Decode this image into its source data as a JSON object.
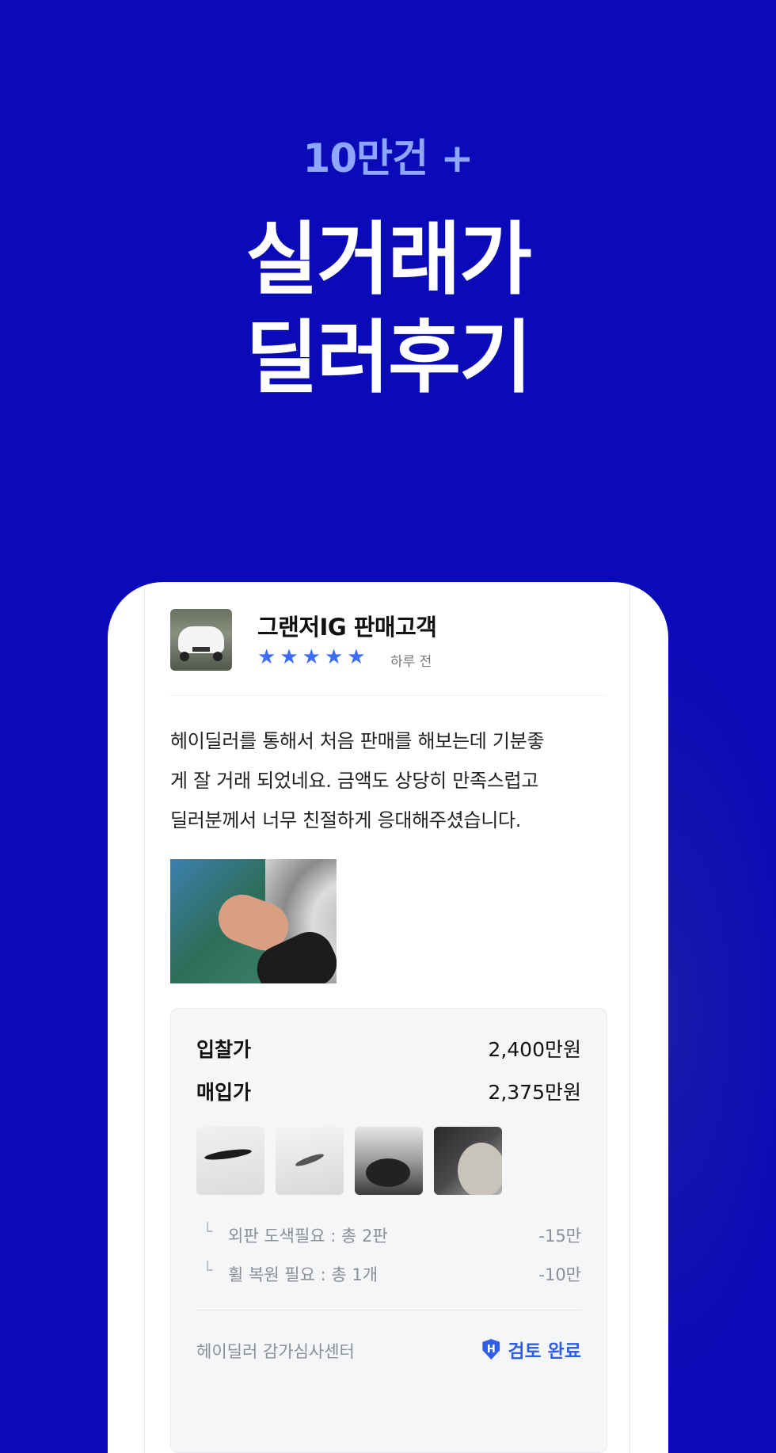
{
  "hero": {
    "badge": "10만건 +",
    "headline_line1": "실거래가",
    "headline_line2": "딜러후기"
  },
  "review": {
    "title": "그랜저IG 판매고객",
    "rating": 5,
    "stars": [
      "★",
      "★",
      "★",
      "★",
      "★"
    ],
    "time_ago": "하루 전",
    "text_lines": [
      "헤이딜러를 통해서 처음 판매를 해보는데 기분좋",
      "게 잘 거래 되었네요. 금액도 상당히 만족스럽고",
      "딜러분께서 너무 친절하게 응대해주셨습니다."
    ]
  },
  "price": {
    "bid_label": "입찰가",
    "bid_value": "2,400만원",
    "purchase_label": "매입가",
    "purchase_value": "2,375만원",
    "deductions": [
      {
        "mark": "└",
        "label": "외판 도색필요 : 총 2판",
        "value": "-15만"
      },
      {
        "mark": "└",
        "label": "휠 복원 필요 : 총 1개",
        "value": "-10만"
      }
    ],
    "center_label": "헤이딜러 감가심사센터",
    "shield_letter": "H",
    "status_label": "검토 완료"
  },
  "colors": {
    "background": "#0a0ab8",
    "badge": "#8fa6ff",
    "accent": "#2f5fe6",
    "star": "#3d6df2"
  }
}
